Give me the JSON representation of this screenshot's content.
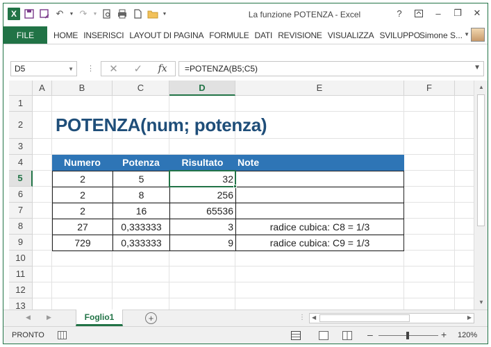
{
  "window": {
    "title": "La funzione POTENZA - Excel"
  },
  "titlebar": {
    "help": "?",
    "minimize": "–",
    "restore": "❐",
    "close": "✕"
  },
  "ribbon": {
    "file_tab": "FILE",
    "tabs": [
      "HOME",
      "INSERISCI",
      "LAYOUT DI PAGINA",
      "FORMULE",
      "DATI",
      "REVISIONE",
      "VISUALIZZA",
      "SVILUPPO"
    ],
    "user_name": "Simone S..."
  },
  "formula_bar": {
    "name_box": "D5",
    "formula": "=POTENZA(B5;C5)",
    "fx_label": "fx"
  },
  "columns": [
    "A",
    "B",
    "C",
    "D",
    "E",
    "F"
  ],
  "rows": [
    "1",
    "2",
    "3",
    "4",
    "5",
    "6",
    "7",
    "8",
    "9",
    "10",
    "11",
    "12",
    "13"
  ],
  "active_cell": "D5",
  "sheet": {
    "title": "POTENZA(num; potenza)",
    "table": {
      "headers": [
        "Numero",
        "Potenza",
        "Risultato",
        "Note"
      ],
      "rows": [
        [
          "2",
          "5",
          "32",
          ""
        ],
        [
          "2",
          "8",
          "256",
          ""
        ],
        [
          "2",
          "16",
          "65536",
          ""
        ],
        [
          "27",
          "0,333333",
          "3",
          "radice cubica: C8  = 1/3"
        ],
        [
          "729",
          "0,333333",
          "9",
          "radice cubica: C9  = 1/3"
        ]
      ]
    }
  },
  "sheet_tabs": {
    "tabs": [
      "Foglio1"
    ],
    "add": "+"
  },
  "status_bar": {
    "mode": "PRONTO",
    "zoom_level": "120%"
  },
  "colors": {
    "excel_green": "#217346",
    "header_blue": "#2e75b6",
    "title_blue": "#1f4e79"
  }
}
